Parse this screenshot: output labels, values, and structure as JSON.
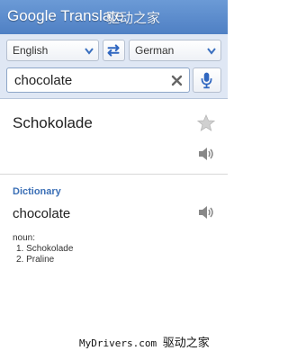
{
  "app": {
    "title": "Google Translate"
  },
  "watermarks": {
    "top": "驱动之家",
    "bottom_site": "MyDrivers.com",
    "bottom_cn": "驱动之家"
  },
  "languages": {
    "source": "English",
    "target": "German"
  },
  "search": {
    "value": "chocolate"
  },
  "result": {
    "translation": "Schokolade"
  },
  "dictionary": {
    "heading": "Dictionary",
    "word": "chocolate",
    "part_of_speech": "noun:",
    "definitions": [
      "1. Schokolade",
      "2. Praline"
    ]
  },
  "colors": {
    "header": "#5a8bcf",
    "accent": "#2f66c0",
    "toolbar": "#dfe7f4"
  },
  "icons": {
    "swap": "swap-arrows-icon",
    "clear": "clear-x-icon",
    "mic": "microphone-icon",
    "star": "star-icon",
    "speaker": "speaker-icon"
  }
}
